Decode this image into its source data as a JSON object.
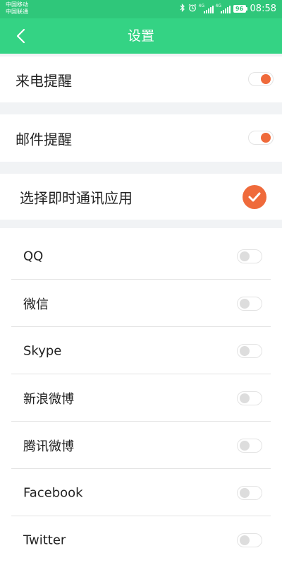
{
  "statusbar": {
    "carrier1": "中国移动",
    "carrier2": "中国联通",
    "signal_tag1": "4G",
    "signal_tag2": "4G",
    "battery": "96",
    "time": "08:58",
    "icons": [
      "bluetooth-icon",
      "alarm-icon",
      "signal-icon",
      "signal-icon",
      "battery-icon"
    ]
  },
  "header": {
    "title": "设置",
    "back_icon": "chevron-left-icon",
    "background": "#34d384"
  },
  "settings": {
    "call_reminder": {
      "label": "来电提醒",
      "enabled": true
    },
    "mail_reminder": {
      "label": "邮件提醒",
      "enabled": true
    },
    "im_select": {
      "label": "选择即时通讯应用",
      "checked": true
    }
  },
  "apps": [
    {
      "label": "QQ",
      "enabled": false
    },
    {
      "label": "微信",
      "enabled": false
    },
    {
      "label": "Skype",
      "enabled": false
    },
    {
      "label": "新浪微博",
      "enabled": false
    },
    {
      "label": "腾讯微博",
      "enabled": false
    },
    {
      "label": "Facebook",
      "enabled": false
    },
    {
      "label": "Twitter",
      "enabled": false
    }
  ],
  "colors": {
    "accent": "#ef6a3b",
    "status_green": "#2fc77a",
    "section_gap": "#f1f3f5"
  }
}
